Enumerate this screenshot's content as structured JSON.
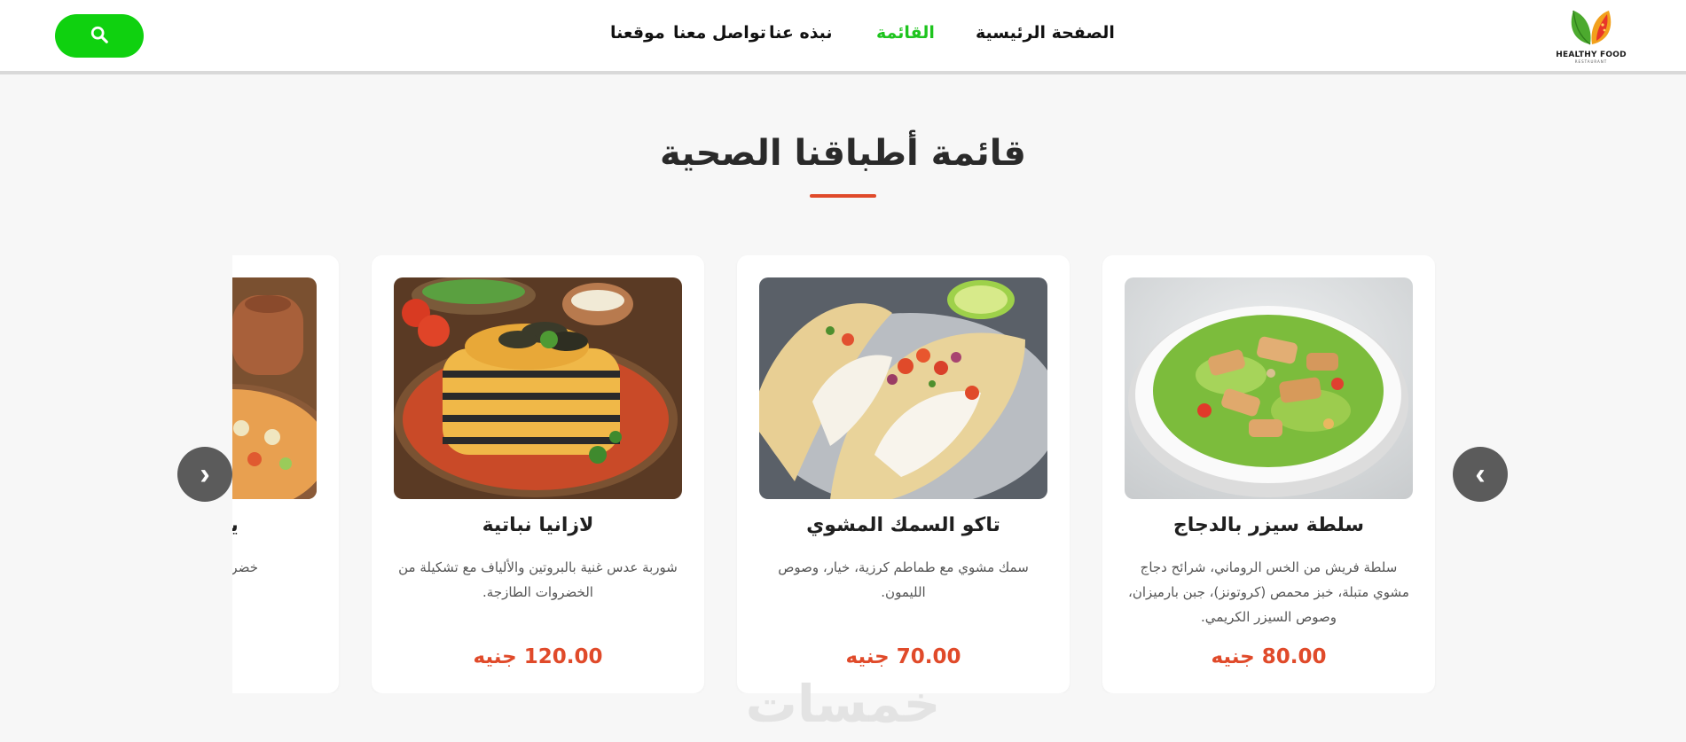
{
  "header": {
    "logo": {
      "text": "HEALTHY FOOD",
      "subtext": "RESTAURANT",
      "icon": "leaf-logo-icon"
    },
    "nav": [
      {
        "label": "الصفحة الرئيسية",
        "active": false
      },
      {
        "label": "القائمة",
        "active": true
      },
      {
        "label": "نبذه عنا",
        "active": false
      },
      {
        "label": "تواصل معنا",
        "active": false
      },
      {
        "label": "موقعنا",
        "active": false
      }
    ],
    "search_icon": "search-icon",
    "colors": {
      "search_button": "#0fd10f",
      "active_nav": "#1ec41e"
    }
  },
  "menu": {
    "title": "قائمة أطباقنا الصحية",
    "accent_color": "#e04a2a",
    "cards": [
      {
        "title": "سلطة سيزر بالدجاج",
        "description": "سلطة فريش من الخس الروماني، شرائح دجاج مشوي متبلة، خبز محمص (كروتونز)، جبن بارميزان، وصوص السيزر الكريمي.",
        "price": "80.00 جنيه",
        "image": "caesar-salad-photo"
      },
      {
        "title": "تاكو السمك المشوي",
        "description": "سمك مشوي مع طماطم كرزية، خيار، وصوص الليمون.",
        "price": "70.00 جنيه",
        "image": "fish-taco-photo"
      },
      {
        "title": "لازانيا نباتية",
        "description": "شوربة عدس غنية بالبروتين والألياف مع تشكيلة من الخضروات الطازجة.",
        "price": "120.00 جنيه",
        "image": "vegetable-lasagna-photo"
      },
      {
        "title": "يخنة خضروات",
        "description": "خضروات مشوية تقدم في وعاء",
        "price": "",
        "image": "vegetable-stew-photo"
      }
    ],
    "arrows": {
      "previous": "‹",
      "next": "›"
    }
  },
  "watermark": "خمسات"
}
